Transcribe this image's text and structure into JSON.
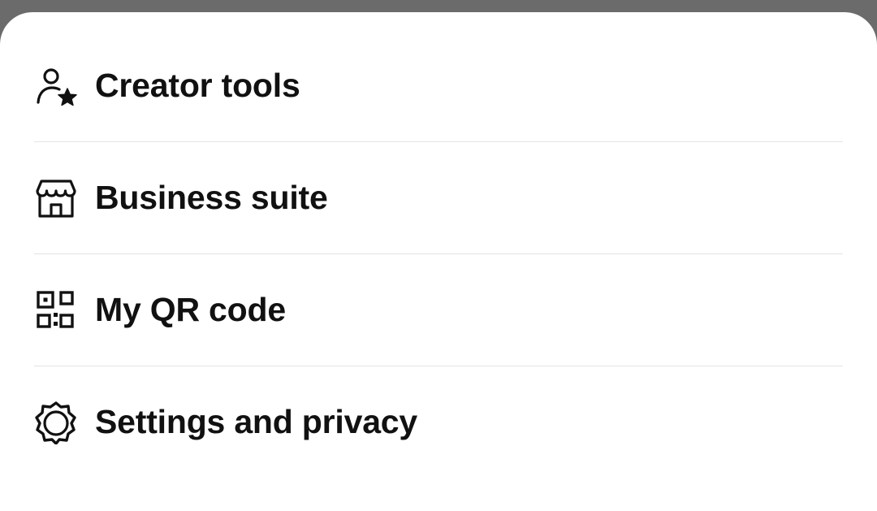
{
  "menu": {
    "items": [
      {
        "label": "Creator tools",
        "icon": "creator-star-icon"
      },
      {
        "label": "Business suite",
        "icon": "storefront-icon"
      },
      {
        "label": "My QR code",
        "icon": "qr-code-icon"
      },
      {
        "label": "Settings and privacy",
        "icon": "gear-icon"
      }
    ]
  },
  "colors": {
    "backdrop": "#6b6b6b",
    "sheet": "#ffffff",
    "text": "#111111",
    "divider": "#e4e4e4"
  }
}
